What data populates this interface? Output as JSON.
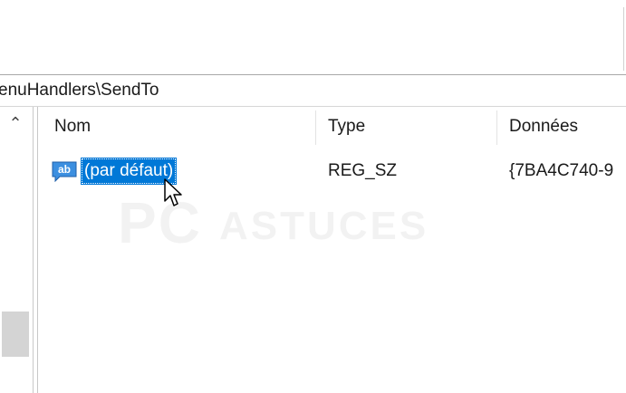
{
  "address": {
    "path": "enuHandlers\\SendTo"
  },
  "columns": {
    "name": "Nom",
    "type": "Type",
    "data": "Données"
  },
  "rows": [
    {
      "name": "(par défaut)",
      "type": "REG_SZ",
      "data": "{7BA4C740-9",
      "icon": "ab-string-icon"
    }
  ],
  "watermark": {
    "text": "PCASTUCES"
  },
  "colors": {
    "selection": "#0078d7",
    "icon_blue": "#3c8fe0"
  }
}
